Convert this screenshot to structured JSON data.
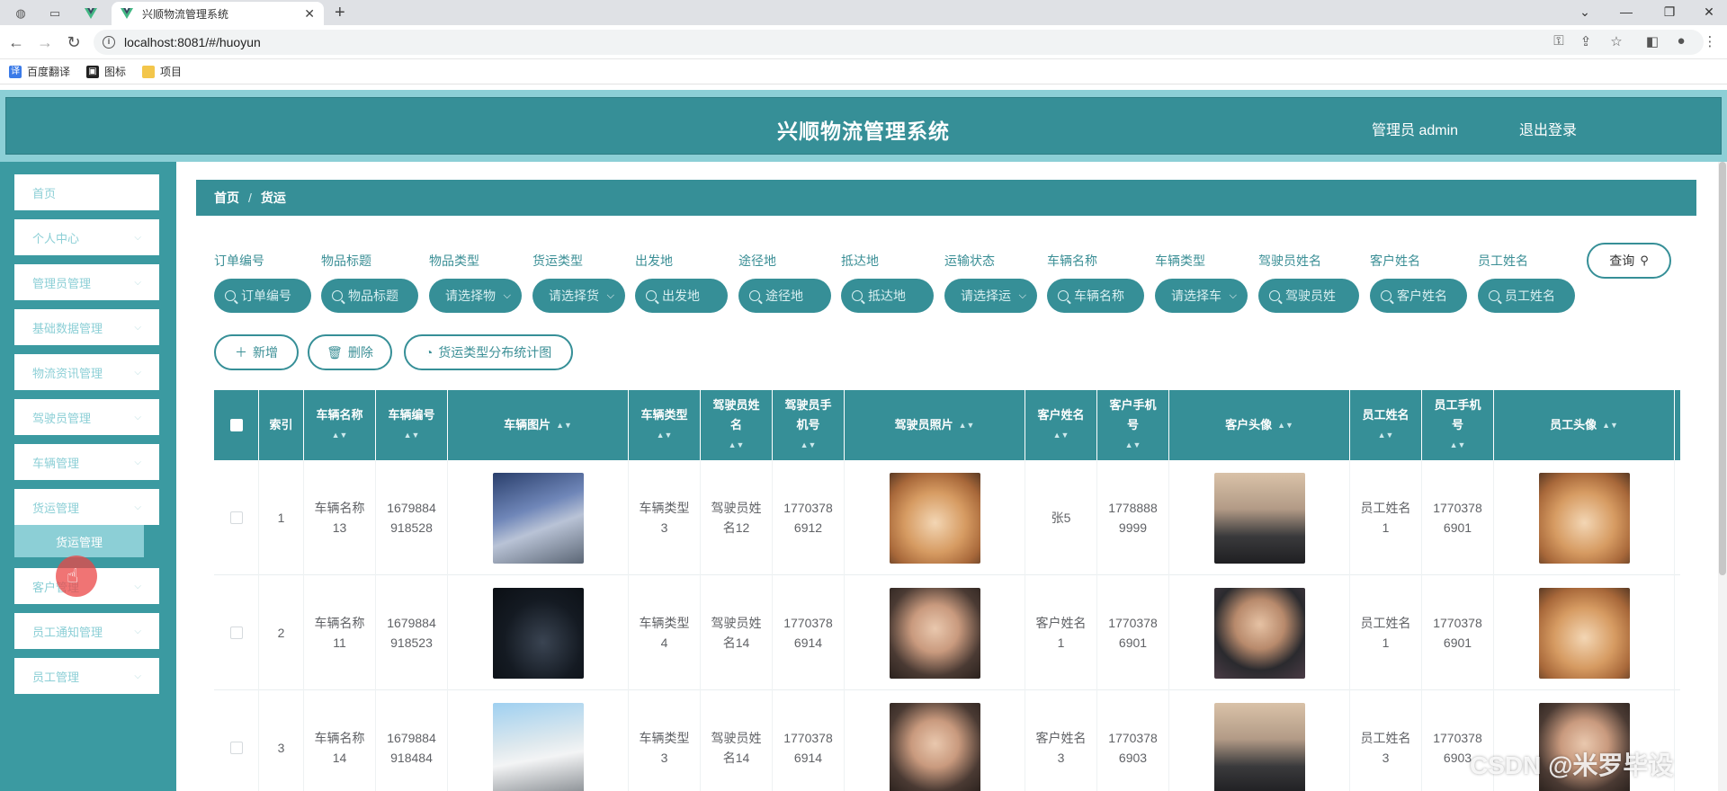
{
  "browser": {
    "tab_title": "兴顺物流管理系统",
    "url": "localhost:8081/#/huoyun",
    "bookmarks": [
      "百度翻译",
      "图标",
      "项目"
    ]
  },
  "header": {
    "title": "兴顺物流管理系统",
    "admin": "管理员 admin",
    "logout": "退出登录"
  },
  "sidebar": {
    "items": [
      "首页",
      "个人中心",
      "管理员管理",
      "基础数据管理",
      "物流资讯管理",
      "驾驶员管理",
      "车辆管理",
      "货运管理",
      "客户管理",
      "员工通知管理",
      "员工管理"
    ],
    "sub": "货运管理"
  },
  "breadcrumb": {
    "home": "首页",
    "sep": "/",
    "current": "货运"
  },
  "filters": {
    "labels": [
      "订单编号",
      "物品标题",
      "物品类型",
      "货运类型",
      "出发地",
      "途径地",
      "抵达地",
      "运输状态",
      "车辆名称",
      "车辆类型",
      "驾驶员姓名",
      "客户姓名",
      "员工姓名"
    ],
    "placeholders": [
      "订单编号",
      "物品标题",
      "请选择物",
      "请选择货",
      "出发地",
      "途径地",
      "抵达地",
      "请选择运",
      "车辆名称",
      "请选择车",
      "驾驶员姓",
      "客户姓名",
      "员工姓名"
    ],
    "query": "查询"
  },
  "actions": {
    "add": "新增",
    "delete": "删除",
    "chart": "货运类型分布统计图"
  },
  "table": {
    "headers": [
      "索引",
      "车辆名称",
      "车辆编号",
      "车辆图片",
      "车辆类型",
      "驾驶员姓名",
      "驾驶员手机号",
      "驾驶员照片",
      "客户姓名",
      "客户手机号",
      "客户头像",
      "员工姓名",
      "员工手机号",
      "员工头像"
    ],
    "rows": [
      {
        "index": "1",
        "car_name": "车辆名称13",
        "car_no": "1679884918528",
        "car_type": "车辆类型3",
        "driver": "驾驶员姓名12",
        "driver_phone": "17703786912",
        "customer": "张5",
        "customer_phone": "17788889999",
        "staff": "员工姓名1",
        "staff_phone": "17703786901"
      },
      {
        "index": "2",
        "car_name": "车辆名称11",
        "car_no": "1679884918523",
        "car_type": "车辆类型4",
        "driver": "驾驶员姓名14",
        "driver_phone": "17703786914",
        "customer": "客户姓名1",
        "customer_phone": "17703786901",
        "staff": "员工姓名1",
        "staff_phone": "17703786901"
      },
      {
        "index": "3",
        "car_name": "车辆名称14",
        "car_no": "1679884918484",
        "car_type": "车辆类型3",
        "driver": "驾驶员姓名14",
        "driver_phone": "17703786914",
        "customer": "客户姓名3",
        "customer_phone": "17703786903",
        "staff": "员工姓名3",
        "staff_phone": "17703786903"
      }
    ]
  },
  "watermark": "CSDN @米罗毕设",
  "colors": {
    "primary": "#368f97",
    "light": "#8ccfd6",
    "sidebar": "#3b9aa1"
  }
}
